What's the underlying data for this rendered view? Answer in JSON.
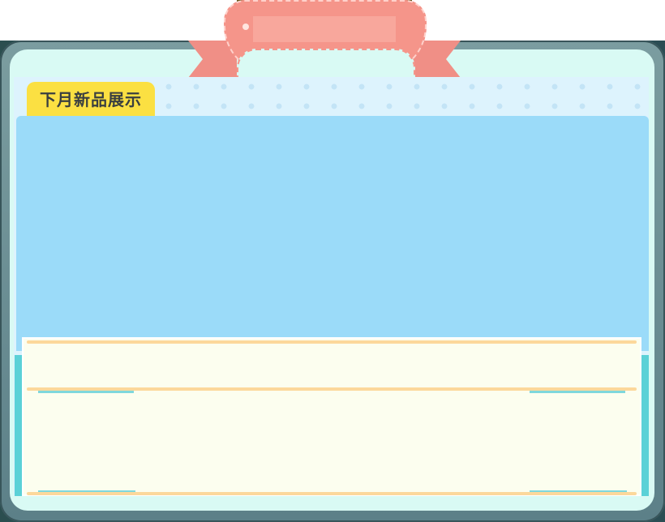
{
  "dialog": {
    "section_title": "下月新品展示"
  },
  "info": {
    "text": ""
  },
  "colors": {
    "title_tab": "#fbe042",
    "preview_area": "#9bdbf9",
    "ribbon": "#f5958a",
    "frame": "#5bd1d7",
    "card": "#fcfeef"
  },
  "icons": {
    "ribbon": "ribbon-banner-icon"
  }
}
